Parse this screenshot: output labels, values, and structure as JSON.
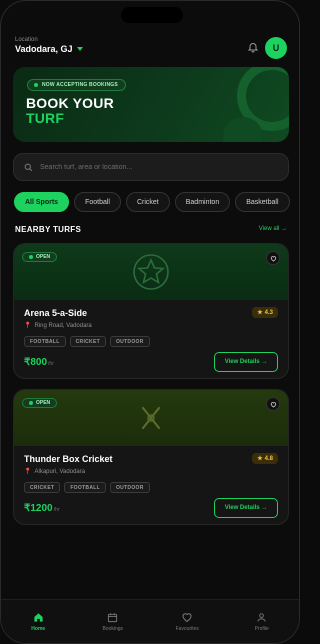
{
  "header": {
    "location_label": "Location",
    "location_value": "Vadodara, GJ",
    "avatar_initial": "U"
  },
  "banner": {
    "chip": "NOW ACCEPTING BOOKINGS",
    "title_line1": "BOOK YOUR",
    "title_line2": "TURF"
  },
  "search": {
    "placeholder": "Search turf, area or location..."
  },
  "filters": [
    "All Sports",
    "Football",
    "Cricket",
    "Badminton",
    "Basketball"
  ],
  "section": {
    "title": "NEARBY TURFS",
    "view_all": "View all →"
  },
  "turfs": [
    {
      "status": "OPEN",
      "name": "Arena 5-a-Side",
      "rating": "4.3",
      "address": "Ring Road, Vadodara",
      "tags": [
        "FOOTBALL",
        "CRICKET",
        "OUTDOOR"
      ],
      "price": "₹800",
      "price_unit": "/hr",
      "cta": "View Details →",
      "icon": "football-icon"
    },
    {
      "status": "OPEN",
      "name": "Thunder Box Cricket",
      "rating": "4.8",
      "address": "Alkapuri, Vadodara",
      "tags": [
        "CRICKET",
        "FOOTBALL",
        "OUTDOOR"
      ],
      "price": "₹1200",
      "price_unit": "/hr",
      "cta": "View Details →",
      "icon": "cricket-bats-icon"
    }
  ],
  "tabs": [
    {
      "label": "Home",
      "icon": "home-icon",
      "active": true
    },
    {
      "label": "Bookings",
      "icon": "calendar-icon",
      "active": false
    },
    {
      "label": "Favourites",
      "icon": "heart-icon",
      "active": false
    },
    {
      "label": "Profile",
      "icon": "user-icon",
      "active": false
    }
  ],
  "colors": {
    "accent": "#1dd25f",
    "background": "#0c0c0c",
    "card": "#151515",
    "rating": "#f2c14e"
  }
}
